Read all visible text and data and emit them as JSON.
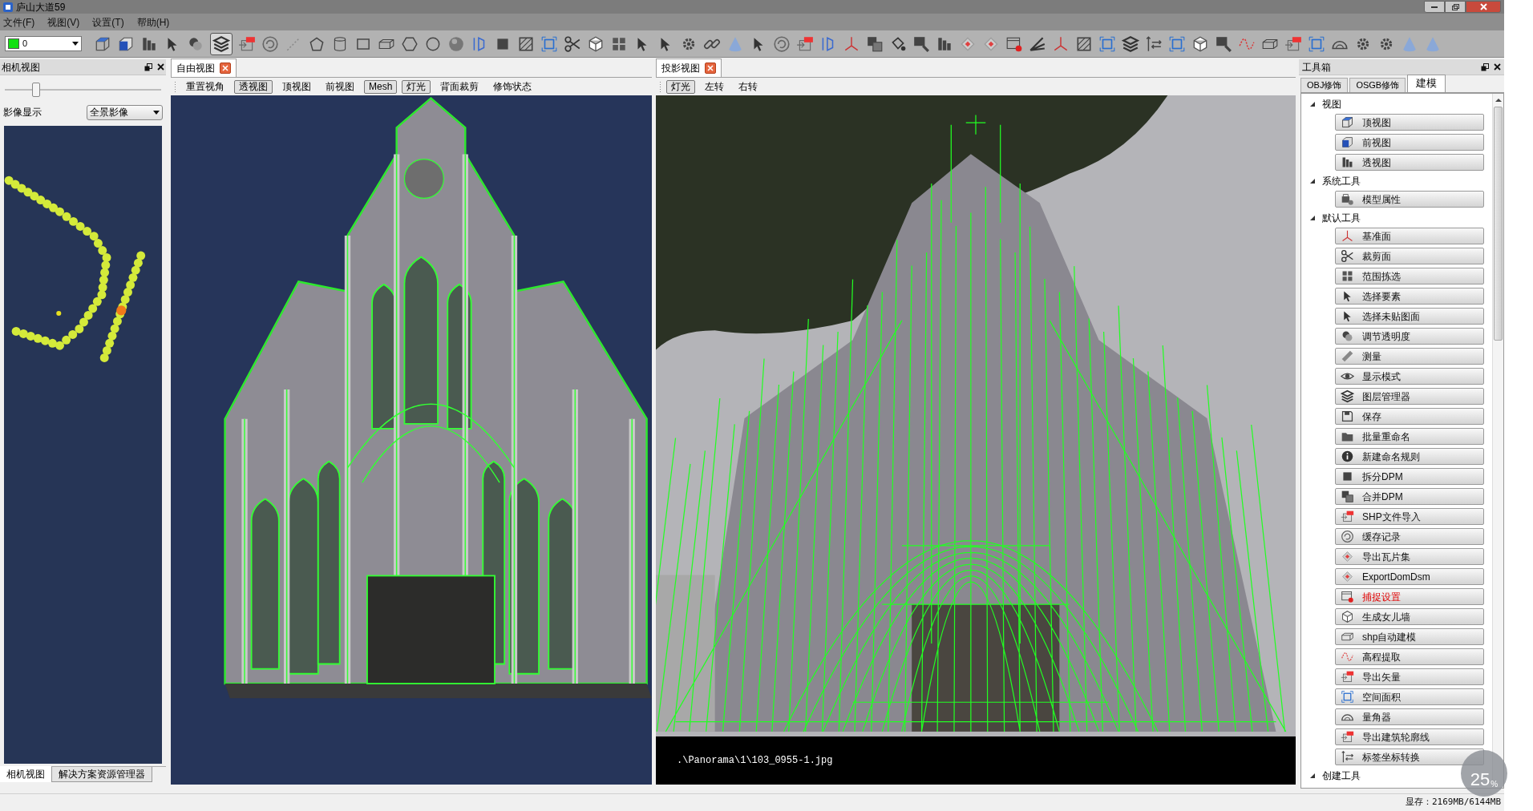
{
  "window": {
    "title": "庐山大道59"
  },
  "menu": [
    "文件(F)",
    "视图(V)",
    "设置(T)",
    "帮助(H)"
  ],
  "toolbar": {
    "layer_value": "0",
    "layers_tool_pressed": true
  },
  "camera_panel": {
    "title": "相机视图",
    "slider": {
      "level": 0.2
    },
    "image_display": {
      "label": "影像显示",
      "value": "全景影像"
    },
    "bottom_tabs": [
      {
        "label": "相机视图",
        "selected": true
      },
      {
        "label": "解决方案资源管理器",
        "selected": false
      }
    ]
  },
  "free_view": {
    "tab": "自由视图",
    "buttons": [
      {
        "label": "重置视角",
        "pressed": false
      },
      {
        "label": "透视图",
        "pressed": true
      },
      {
        "label": "顶视图",
        "pressed": false
      },
      {
        "label": "前视图",
        "pressed": false
      },
      {
        "label": "Mesh",
        "pressed": true
      },
      {
        "label": "灯光",
        "pressed": true
      },
      {
        "label": "背面裁剪",
        "pressed": false
      },
      {
        "label": "修饰状态",
        "pressed": false
      }
    ]
  },
  "projection_view": {
    "tab": "投影视图",
    "buttons": [
      {
        "label": "灯光",
        "pressed": true
      },
      {
        "label": "左转",
        "pressed": false
      },
      {
        "label": "右转",
        "pressed": false
      }
    ],
    "image_path": ".\\Panorama\\1\\103_0955-1.jpg"
  },
  "toolbox": {
    "title": "工具箱",
    "tabs": [
      {
        "label": "OBJ修饰",
        "selected": false
      },
      {
        "label": "OSGB修饰",
        "selected": false
      },
      {
        "label": "建模",
        "selected": true
      }
    ],
    "groups": [
      {
        "label": "视图",
        "expanded": true,
        "items": [
          {
            "label": "顶视图",
            "highlighted": false
          },
          {
            "label": "前视图",
            "highlighted": false
          },
          {
            "label": "透视图",
            "highlighted": false
          }
        ]
      },
      {
        "label": "系统工具",
        "expanded": true,
        "items": [
          {
            "label": "模型属性",
            "highlighted": false
          }
        ]
      },
      {
        "label": "默认工具",
        "expanded": true,
        "items": [
          {
            "label": "基准面",
            "highlighted": false
          },
          {
            "label": "裁剪面",
            "highlighted": false
          },
          {
            "label": "范围拣选",
            "highlighted": false
          },
          {
            "label": "选择要素",
            "highlighted": false
          },
          {
            "label": "选择未贴图面",
            "highlighted": false
          },
          {
            "label": "调节透明度",
            "highlighted": false
          },
          {
            "label": "测量",
            "highlighted": false
          },
          {
            "label": "显示模式",
            "highlighted": false
          },
          {
            "label": "图层管理器",
            "highlighted": false
          },
          {
            "label": "保存",
            "highlighted": false
          },
          {
            "label": "批量重命名",
            "highlighted": false
          },
          {
            "label": "新建命名规则",
            "highlighted": false
          },
          {
            "label": "拆分DPM",
            "highlighted": false
          },
          {
            "label": "合并DPM",
            "highlighted": false
          },
          {
            "label": "SHP文件导入",
            "highlighted": false
          },
          {
            "label": "缓存记录",
            "highlighted": false
          },
          {
            "label": "导出瓦片集",
            "highlighted": false
          },
          {
            "label": "ExportDomDsm",
            "highlighted": false
          },
          {
            "label": "捕捉设置",
            "highlighted": true
          },
          {
            "label": "生成女儿墙",
            "highlighted": false
          },
          {
            "label": "shp自动建模",
            "highlighted": false
          },
          {
            "label": "高程提取",
            "highlighted": false
          },
          {
            "label": "导出矢量",
            "highlighted": false
          },
          {
            "label": "空间面积",
            "highlighted": false
          },
          {
            "label": "量角器",
            "highlighted": false
          },
          {
            "label": "导出建筑轮廓线",
            "highlighted": false
          },
          {
            "label": "标签坐标转换",
            "highlighted": false
          }
        ]
      },
      {
        "label": "创建工具",
        "expanded": true
      }
    ]
  },
  "gauge": {
    "value": "25",
    "unit": "%"
  },
  "status_bar": {
    "memory": "显存：2169MB/6144MB"
  }
}
